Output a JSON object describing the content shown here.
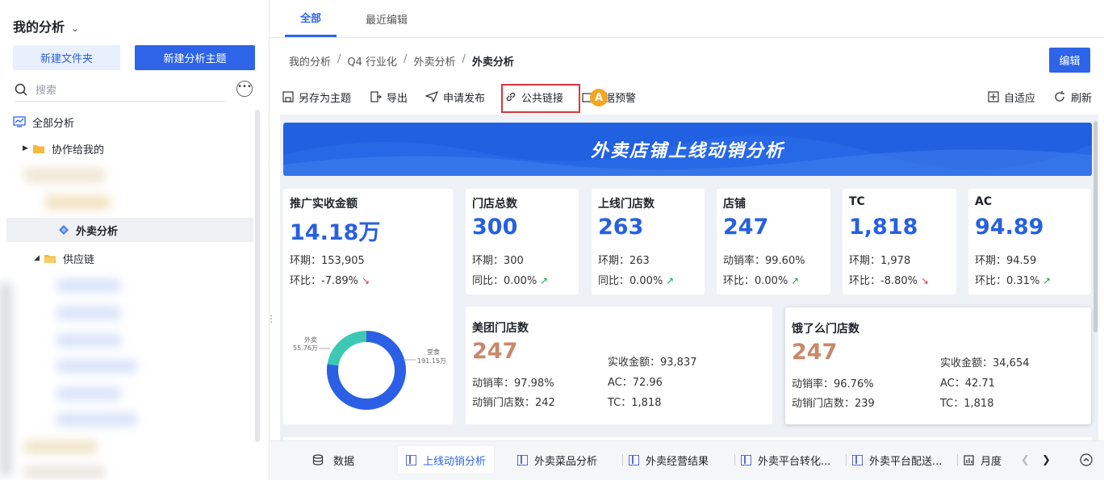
{
  "sidebar": {
    "title": "我的分析",
    "new_folder": "新建文件夹",
    "new_topic": "新建分析主题",
    "search_placeholder": "搜索",
    "tree": {
      "all": "全部分析",
      "shared": "协作给我的",
      "takeout": "外卖分析",
      "supply": "供应链"
    }
  },
  "tabs": [
    "全部",
    "最近编辑"
  ],
  "breadcrumb": [
    "我的分析",
    "Q4 行业化",
    "外卖分析",
    "外卖分析"
  ],
  "edit_label": "编辑",
  "toolbar": {
    "save_as": "另存为主题",
    "export": "导出",
    "publish": "申请发布",
    "public_link": "公共链接",
    "alert": "据预警",
    "fit": "自适应",
    "refresh": "刷新",
    "badge": "A"
  },
  "dashboard": {
    "title": "外卖店铺上线动销分析",
    "promo": {
      "label": "推广实收金额",
      "value": "14.18万",
      "l1": "环期：153,905",
      "l2": "环比：-7.89%"
    },
    "donut": {
      "left_name": "外卖",
      "left_value": "55.76万",
      "right_name": "堂食",
      "right_value": "191.15万",
      "share": 0.226
    },
    "kpis": [
      {
        "label": "门店总数",
        "value": "300",
        "l1": "环期：300",
        "l2": "同比：0.00%",
        "trend": "up"
      },
      {
        "label": "上线门店数",
        "value": "263",
        "l1": "环期：263",
        "l2": "同比：0.00%",
        "trend": "up"
      },
      {
        "label": "店铺",
        "value": "247",
        "l1": "动销率：99.60%",
        "l2": "环比：0.00%",
        "trend": "up"
      },
      {
        "label": "TC",
        "value": "1,818",
        "l1": "环期：1,978",
        "l2": "环比：-8.80%",
        "trend": "down"
      },
      {
        "label": "AC",
        "value": "94.89",
        "l1": "环期：94.59",
        "l2": "环比：0.31%",
        "trend": "up"
      }
    ],
    "meituan": {
      "label": "美团门店数",
      "value": "247",
      "rate": "动销率：97.98%",
      "stores": "动销门店数：242",
      "amount": "实收金额：93,837",
      "ac": "AC：72.96",
      "tc": "TC：1,818"
    },
    "eleme": {
      "label": "饿了么门店数",
      "value": "247",
      "rate": "动销率：96.76%",
      "stores": "动销门店数：239",
      "amount": "实收金额：34,654",
      "ac": "AC：42.71",
      "tc": "TC：1,818"
    }
  },
  "bottom_tabs": {
    "data": "数据",
    "sheets": [
      "上线动销分析",
      "外卖菜品分析",
      "外卖经营结果",
      "外卖平台转化...",
      "外卖平台配送...",
      "月度"
    ]
  },
  "colors": {
    "accent": "#2d64e8",
    "orange": "#c9886a",
    "teal": "#3cc8b4"
  }
}
